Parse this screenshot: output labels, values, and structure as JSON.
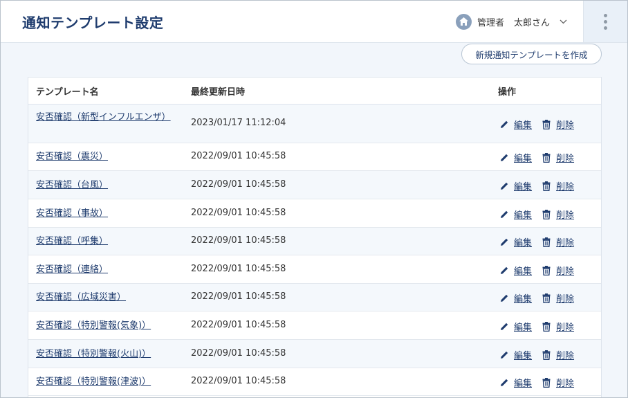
{
  "header": {
    "title": "通知テンプレート設定",
    "user_role": "管理者",
    "user_name": "太郎さん"
  },
  "actions": {
    "create_label": "新規通知テンプレートを作成"
  },
  "table": {
    "columns": [
      "テンプレート名",
      "最終更新日時",
      "操作"
    ],
    "edit_label": "編集",
    "delete_label": "削除",
    "rows": [
      {
        "name": "安否確認（新型インフルエンザ）",
        "updated": "2023/01/17 11:12:04"
      },
      {
        "name": "安否確認（震災）",
        "updated": "2022/09/01 10:45:58"
      },
      {
        "name": "安否確認（台風）",
        "updated": "2022/09/01 10:45:58"
      },
      {
        "name": "安否確認（事故）",
        "updated": "2022/09/01 10:45:58"
      },
      {
        "name": "安否確認（呼集）",
        "updated": "2022/09/01 10:45:58"
      },
      {
        "name": "安否確認（連絡）",
        "updated": "2022/09/01 10:45:58"
      },
      {
        "name": "安否確認（広域災害）",
        "updated": "2022/09/01 10:45:58"
      },
      {
        "name": "安否確認（特別警報(気象)）",
        "updated": "2022/09/01 10:45:58"
      },
      {
        "name": "安否確認（特別警報(火山)）",
        "updated": "2022/09/01 10:45:58"
      },
      {
        "name": "安否確認（特別警報(津波)）",
        "updated": "2022/09/01 10:45:58"
      }
    ]
  },
  "colors": {
    "primary": "#1f3c6e",
    "background": "#f2f6fb",
    "row_alt": "#f4f8fc"
  }
}
